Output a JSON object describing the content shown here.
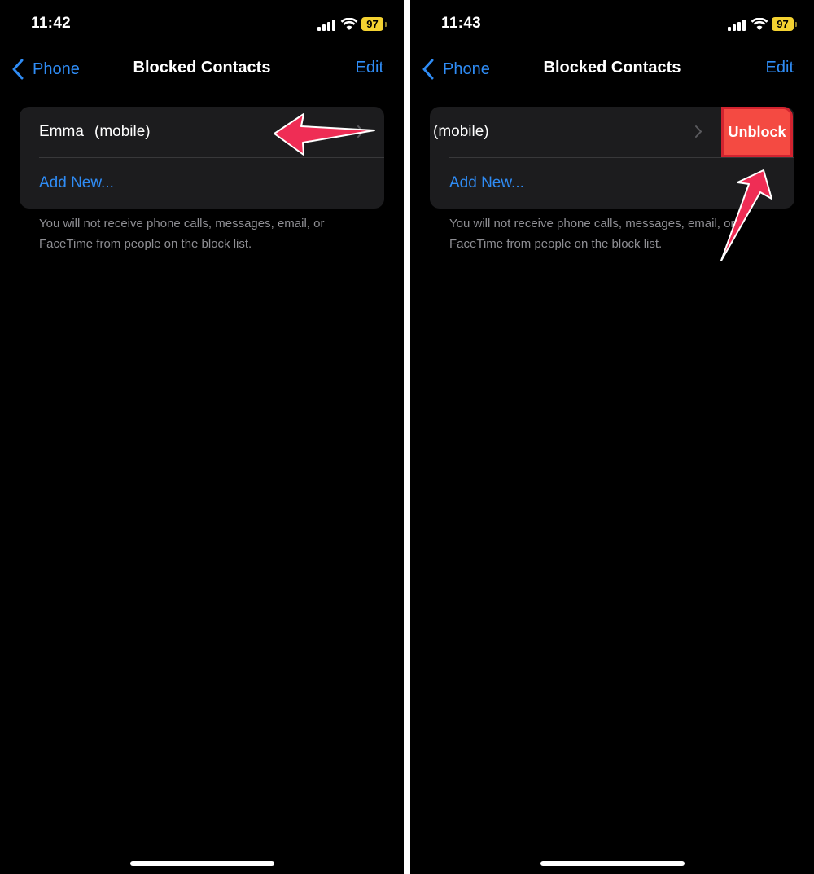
{
  "screens": [
    {
      "status_bar": {
        "time": "11:42",
        "battery": "97"
      },
      "nav": {
        "back_label": "Phone",
        "title": "Blocked Contacts",
        "edit_label": "Edit"
      },
      "contact": {
        "name": "Emma",
        "type": "(mobile)"
      },
      "add_new_label": "Add New...",
      "footer_note": "You will not receive phone calls, messages, email, or FaceTime from people on the block list."
    },
    {
      "status_bar": {
        "time": "11:43",
        "battery": "97"
      },
      "nav": {
        "back_label": "Phone",
        "title": "Blocked Contacts",
        "edit_label": "Edit"
      },
      "contact": {
        "type": "(mobile)"
      },
      "swipe_action_label": "Unblock",
      "add_new_label": "Add New...",
      "footer_note": "You will not receive phone calls, messages, email, or FaceTime from people on the block list."
    }
  ],
  "colors": {
    "background": "#000000",
    "group_background": "#1c1c1e",
    "accent_blue": "#2f8cf5",
    "unblock_red": "#f44a42",
    "battery_yellow": "#f4d231",
    "annotation_arrow": "#ef2d55"
  }
}
